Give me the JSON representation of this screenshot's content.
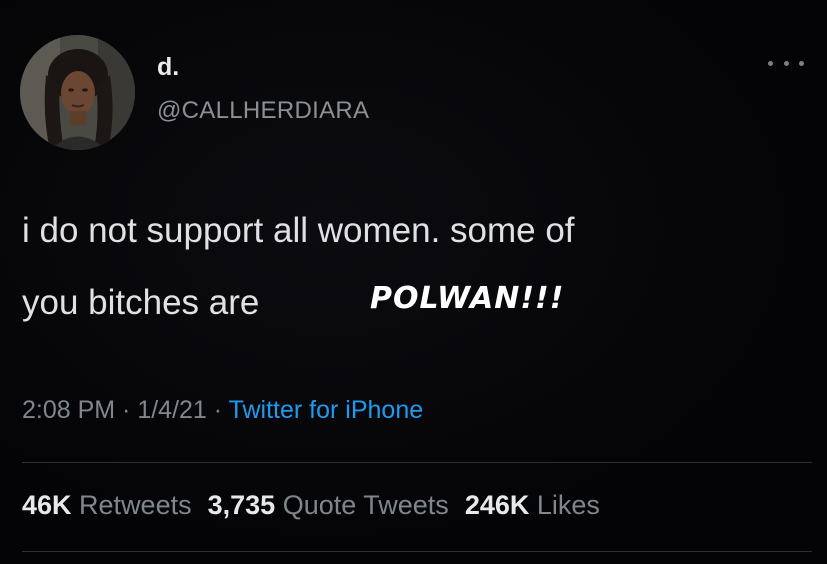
{
  "author": {
    "display_name": "d.",
    "handle": "@CALLHERDIARA",
    "avatar_icon": "profile-photo-avatar"
  },
  "menu": {
    "icon": "more-options-icon"
  },
  "tweet": {
    "line1": "i do not support all women. some of",
    "line2": "you bitches are",
    "overlay_text": "POLWAN!!!"
  },
  "meta": {
    "time": "2:08 PM",
    "separator1": " · ",
    "date": "1/4/21",
    "separator2": " · ",
    "source": "Twitter for iPhone"
  },
  "stats": {
    "retweets_count": "46K",
    "retweets_label": "Retweets",
    "quotes_count": "3,735",
    "quotes_label": "Quote Tweets",
    "likes_count": "246K",
    "likes_label": "Likes"
  },
  "colors": {
    "background": "#050507",
    "primary_text": "#e7e9ea",
    "secondary_text": "#7f868c",
    "link": "#1d9bf0"
  }
}
